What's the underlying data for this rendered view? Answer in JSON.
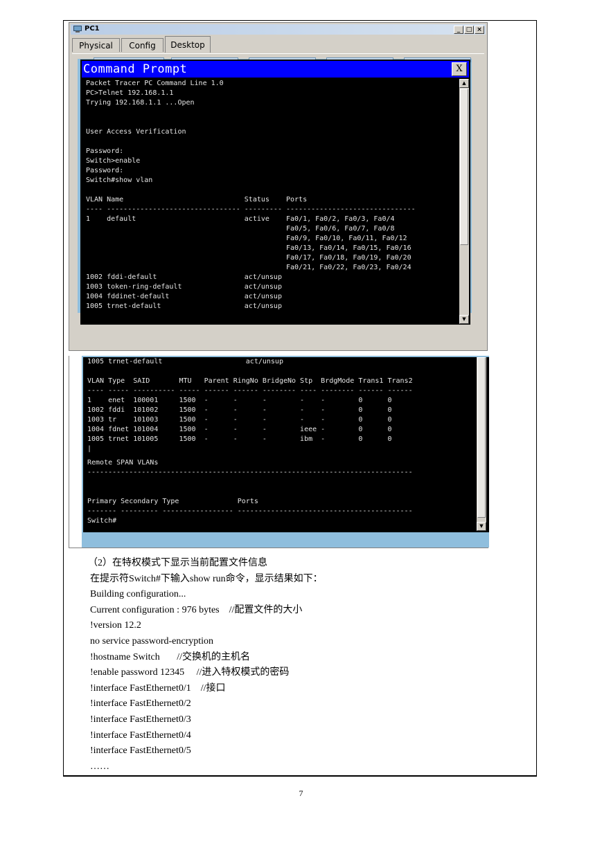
{
  "pc_window": {
    "title": "PC1",
    "tabs": [
      "Physical",
      "Config",
      "Desktop"
    ],
    "active_tab": "Desktop",
    "window_controls": [
      "_",
      "□",
      "×"
    ]
  },
  "command_prompt": {
    "title": "Command Prompt",
    "close_label": "X",
    "lines": [
      "Packet Tracer PC Command Line 1.0",
      "PC>Telnet 192.168.1.1",
      "Trying 192.168.1.1 ...Open",
      "",
      "",
      "User Access Verification",
      "",
      "Password:",
      "Switch>enable",
      "Password:",
      "Switch#show vlan",
      "",
      "VLAN Name                             Status    Ports",
      "---- -------------------------------- --------- -------------------------------",
      "1    default                          active    Fa0/1, Fa0/2, Fa0/3, Fa0/4",
      "                                                Fa0/5, Fa0/6, Fa0/7, Fa0/8",
      "                                                Fa0/9, Fa0/10, Fa0/11, Fa0/12",
      "                                                Fa0/13, Fa0/14, Fa0/15, Fa0/16",
      "                                                Fa0/17, Fa0/18, Fa0/19, Fa0/20",
      "                                                Fa0/21, Fa0/22, Fa0/23, Fa0/24",
      "1002 fddi-default                     act/unsup",
      "1003 token-ring-default               act/unsup",
      "1004 fddinet-default                  act/unsup",
      "1005 trnet-default                    act/unsup"
    ]
  },
  "command_prompt_2": {
    "lines_a": [
      "1005 trnet-default                    act/unsup",
      "",
      "VLAN Type  SAID       MTU   Parent RingNo BridgeNo Stp  BrdgMode Trans1 Trans2",
      "---- ----- ---------- ----- ------ ------ -------- ---- -------- ------ ------",
      "1    enet  100001     1500  -      -      -        -    -        0      0",
      "1002 fddi  101002     1500  -      -      -        -    -        0      0",
      "1003 tr    101003     1500  -      -      -        -    -        0      0",
      "1004 fdnet 101004     1500  -      -      -        ieee -        0      0",
      "1005 trnet 101005     1500  -      -      -        ibm  -        0      0",
      "|"
    ],
    "lines_b": [
      "Remote SPAN VLANs",
      "------------------------------------------------------------------------------",
      "",
      "",
      "Primary Secondary Type              Ports",
      "------- --------- ----------------- ------------------------------------------",
      "Switch#"
    ]
  },
  "document": {
    "lines": [
      "（2）在特权模式下显示当前配置文件信息",
      "在提示符Switch#下输入show run命令，显示结果如下：",
      "Building configuration...",
      "Current configuration : 976 bytes    //配置文件的大小",
      "!version 12.2",
      "no service password-encryption",
      "!hostname Switch       //交换机的主机名",
      "!enable password 12345     //进入特权模式的密码",
      "!interface FastEthernet0/1    //接口",
      "!interface FastEthernet0/2",
      "!interface FastEthernet0/3",
      "!interface FastEthernet0/4",
      "!interface FastEthernet0/5",
      "……"
    ],
    "page_number": "7"
  },
  "colors": {
    "cmd_title_blue": "#0000ff",
    "desktop_blue": "#8fbedd",
    "terminal_bg": "#000000",
    "terminal_fg": "#e6e6e6"
  }
}
